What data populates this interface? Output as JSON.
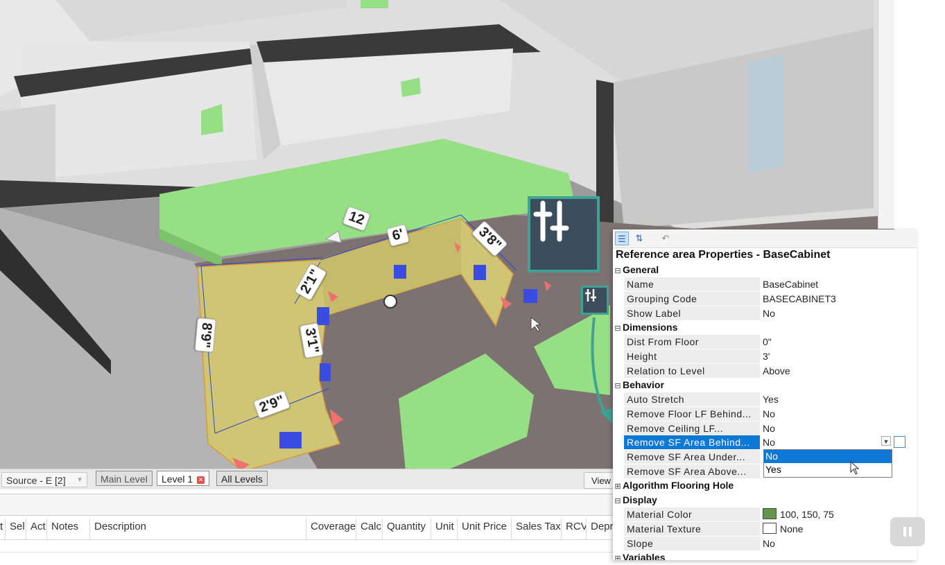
{
  "scene": {
    "dimension_labels": [
      "12",
      "6'",
      "3'8\"",
      "2'1\"",
      "3'1\"",
      "8'9\"",
      "2'9\""
    ],
    "colors": {
      "wall": "#e6e6e6",
      "floor": "#7d7272",
      "green": "#96df85",
      "cabinet": "#cfc574",
      "accent": "#3ea392"
    }
  },
  "tool_icon": "sliders-icon",
  "tab_bar": {
    "source": "Source - E [2]",
    "tabs": [
      "Main Level",
      "Level 1",
      "All Levels"
    ],
    "view": "View"
  },
  "table": {
    "columns": [
      "t",
      "Sel",
      "Act",
      "Notes",
      "Description",
      "Coverage",
      "Calc",
      "Quantity",
      "Unit",
      "Unit Price",
      "Sales Tax",
      "RCV",
      "Depr"
    ]
  },
  "properties": {
    "title": "Reference area Properties - BaseCabinet",
    "categories": {
      "general": "General",
      "dimensions": "Dimensions",
      "behavior": "Behavior",
      "algorithm": "Algorithm Flooring Hole",
      "display": "Display",
      "variables": "Variables"
    },
    "general": [
      {
        "name": "Name",
        "value": "BaseCabinet"
      },
      {
        "name": "Grouping Code",
        "value": "BASECABINET3"
      },
      {
        "name": "Show Label",
        "value": "No"
      }
    ],
    "dimensions": [
      {
        "name": "Dist From Floor",
        "value": "0\""
      },
      {
        "name": "Height",
        "value": "3'"
      },
      {
        "name": "Relation to Level",
        "value": "Above"
      }
    ],
    "behavior": [
      {
        "name": "Auto Stretch",
        "value": "Yes"
      },
      {
        "name": "Remove Floor LF Behind...",
        "value": "No"
      },
      {
        "name": "Remove Ceiling LF...",
        "value": "No"
      },
      {
        "name": "Remove SF Area Behind...",
        "value": "No"
      },
      {
        "name": "Remove SF Area Under...",
        "value": ""
      },
      {
        "name": "Remove SF Area Above...",
        "value": ""
      }
    ],
    "display": [
      {
        "name": "Material Color",
        "value": "100, 150, 75",
        "swatch": "#64964b"
      },
      {
        "name": "Material Texture",
        "value": "None",
        "swatch": "#ffffff"
      },
      {
        "name": "Slope",
        "value": "No"
      }
    ],
    "dropdown_options": [
      "No",
      "Yes"
    ]
  }
}
